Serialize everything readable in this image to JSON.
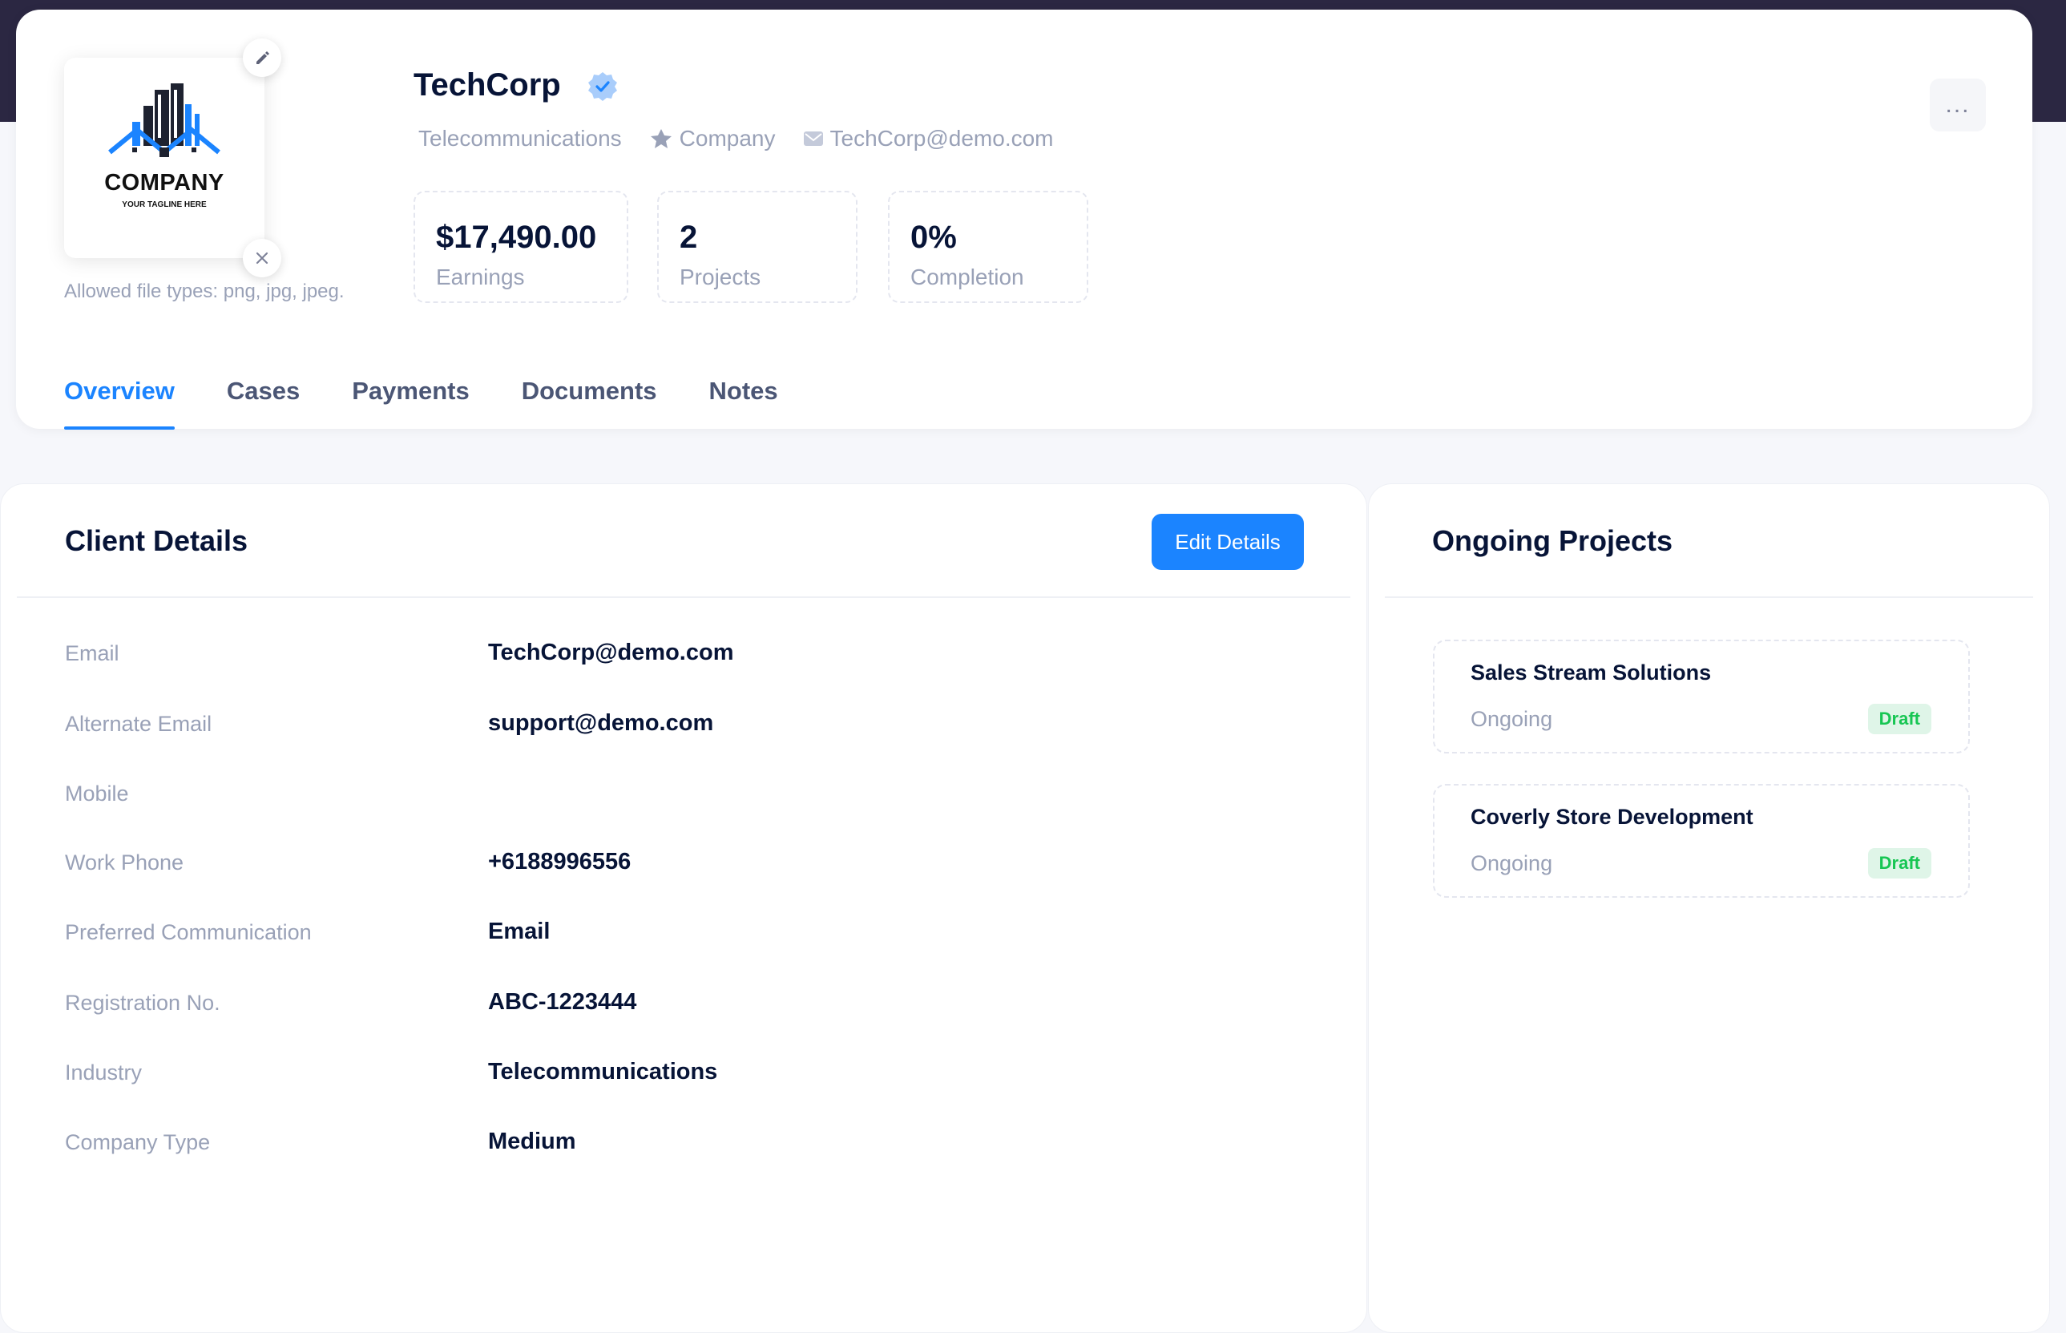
{
  "header": {
    "logo": {
      "name": "COMPANY",
      "tagline": "YOUR TAGLINE HERE"
    },
    "file_types_note": "Allowed file types: png, jpg, jpeg.",
    "client_name": "TechCorp",
    "meta": {
      "industry": "Telecommunications",
      "type": "Company",
      "email": "TechCorp@demo.com"
    },
    "stats": [
      {
        "value": "$17,490.00",
        "label": "Earnings"
      },
      {
        "value": "2",
        "label": "Projects"
      },
      {
        "value": "0%",
        "label": "Completion"
      }
    ],
    "more_menu": "..."
  },
  "tabs": [
    {
      "label": "Overview",
      "active": true
    },
    {
      "label": "Cases"
    },
    {
      "label": "Payments"
    },
    {
      "label": "Documents"
    },
    {
      "label": "Notes"
    }
  ],
  "client_details": {
    "title": "Client Details",
    "edit_label": "Edit Details",
    "rows": [
      {
        "label": "Email",
        "value": "TechCorp@demo.com"
      },
      {
        "label": "Alternate Email",
        "value": "support@demo.com"
      },
      {
        "label": "Mobile",
        "value": ""
      },
      {
        "label": "Work Phone",
        "value": "+6188996556"
      },
      {
        "label": "Preferred Communication",
        "value": "Email"
      },
      {
        "label": "Registration No.",
        "value": "ABC-1223444"
      },
      {
        "label": "Industry",
        "value": "Telecommunications"
      },
      {
        "label": "Company Type",
        "value": "Medium"
      }
    ]
  },
  "ongoing_projects": {
    "title": "Ongoing Projects",
    "items": [
      {
        "name": "Sales Stream Solutions",
        "status": "Ongoing",
        "badge": "Draft"
      },
      {
        "name": "Coverly Store Development",
        "status": "Ongoing",
        "badge": "Draft"
      }
    ]
  },
  "colors": {
    "accent": "#1b84ff",
    "success": "#17c653",
    "header_band": "#2b2742"
  }
}
